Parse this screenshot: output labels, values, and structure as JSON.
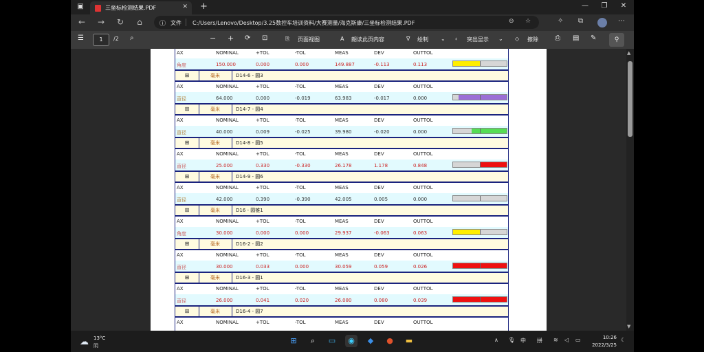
{
  "browser": {
    "tab_title": "三坐标检测结果.PDF",
    "file_label": "文件",
    "url": "C:/Users/Lenovo/Desktop/3.25数控车培训资料/大赛测量/海克斯康/三坐标检测结果.PDF"
  },
  "pdf_toolbar": {
    "page": "1",
    "total": "/2",
    "page_view": "页面视图",
    "read_aloud": "朗读此页内容",
    "draw": "绘制",
    "highlight": "突出显示",
    "erase": "擦除"
  },
  "report": {
    "col_headers": [
      "AX",
      "NOMINAL",
      "+TOL",
      "-TOL",
      "MEAS",
      "DEV",
      "OUTTOL"
    ],
    "rows": [
      {
        "grid": "",
        "unit": "",
        "name": "",
        "ax": "角度",
        "nominal": "150.000",
        "ptol": "0.000",
        "ntol": "0.000",
        "meas": "149.887",
        "dev": "-0.113",
        "outtol": "0.113",
        "bar_color": "#ffee00",
        "bar_side": "left",
        "bar_level": 0.5,
        "red": true
      },
      {
        "grid": "⊞",
        "unit": "毫米",
        "name": "D14-6 - 圆3",
        "ax": "直径",
        "nominal": "64.000",
        "ptol": "0.000",
        "ntol": "-0.019",
        "meas": "63.983",
        "dev": "-0.017",
        "outtol": "0.000",
        "bar_color": "#9b6fd6",
        "bar_side": "right",
        "bar_level": 0.9,
        "red": false
      },
      {
        "grid": "⊞",
        "unit": "毫米",
        "name": "D14-7 - 圆4",
        "ax": "直径",
        "nominal": "40.000",
        "ptol": "0.009",
        "ntol": "-0.025",
        "meas": "39.980",
        "dev": "-0.020",
        "outtol": "0.000",
        "bar_color": "#55dd55",
        "bar_side": "right",
        "bar_level": 0.65,
        "red": false
      },
      {
        "grid": "⊞",
        "unit": "毫米",
        "name": "D14-8 - 圆5",
        "ax": "直径",
        "nominal": "25.000",
        "ptol": "0.330",
        "ntol": "-0.330",
        "meas": "26.178",
        "dev": "1.178",
        "outtol": "0.848",
        "bar_color": "#ee1111",
        "bar_side": "right",
        "bar_level": 0.5,
        "red": true
      },
      {
        "grid": "⊞",
        "unit": "毫米",
        "name": "D14-9 - 圆6",
        "ax": "直径",
        "nominal": "42.000",
        "ptol": "0.390",
        "ntol": "-0.390",
        "meas": "42.005",
        "dev": "0.005",
        "outtol": "0.000",
        "bar_color": "#d6d6d6",
        "bar_side": "right",
        "bar_level": 0.0,
        "red": false
      },
      {
        "grid": "⊞",
        "unit": "毫米",
        "name": "D16 - 圆锥1",
        "ax": "角度",
        "nominal": "30.000",
        "ptol": "0.000",
        "ntol": "0.000",
        "meas": "29.937",
        "dev": "-0.063",
        "outtol": "0.063",
        "bar_color": "#ffee00",
        "bar_side": "left",
        "bar_level": 0.5,
        "red": true
      },
      {
        "grid": "⊞",
        "unit": "毫米",
        "name": "D16-2 - 圆2",
        "ax": "直径",
        "nominal": "30.000",
        "ptol": "0.033",
        "ntol": "0.000",
        "meas": "30.059",
        "dev": "0.059",
        "outtol": "0.026",
        "bar_color": "#ee1111",
        "bar_side": "full",
        "bar_level": 1.0,
        "red": true
      },
      {
        "grid": "⊞",
        "unit": "毫米",
        "name": "D16-3 - 圆1",
        "ax": "直径",
        "nominal": "26.000",
        "ptol": "0.041",
        "ntol": "0.020",
        "meas": "26.080",
        "dev": "0.080",
        "outtol": "0.039",
        "bar_color": "#ee1111",
        "bar_side": "full",
        "bar_level": 1.0,
        "red": true
      },
      {
        "grid": "⊞",
        "unit": "毫米",
        "name": "D16-4 - 圆7",
        "ax": "",
        "nominal": "",
        "ptol": "",
        "ntol": "",
        "meas": "",
        "dev": "",
        "outtol": "",
        "bar_color": "",
        "bar_side": "none",
        "bar_level": 0,
        "red": false
      }
    ]
  },
  "taskbar": {
    "temp": "13°C",
    "condition": "阴",
    "ime": "中",
    "ime2": "拼",
    "time": "10:26",
    "date": "2022/3/25"
  }
}
